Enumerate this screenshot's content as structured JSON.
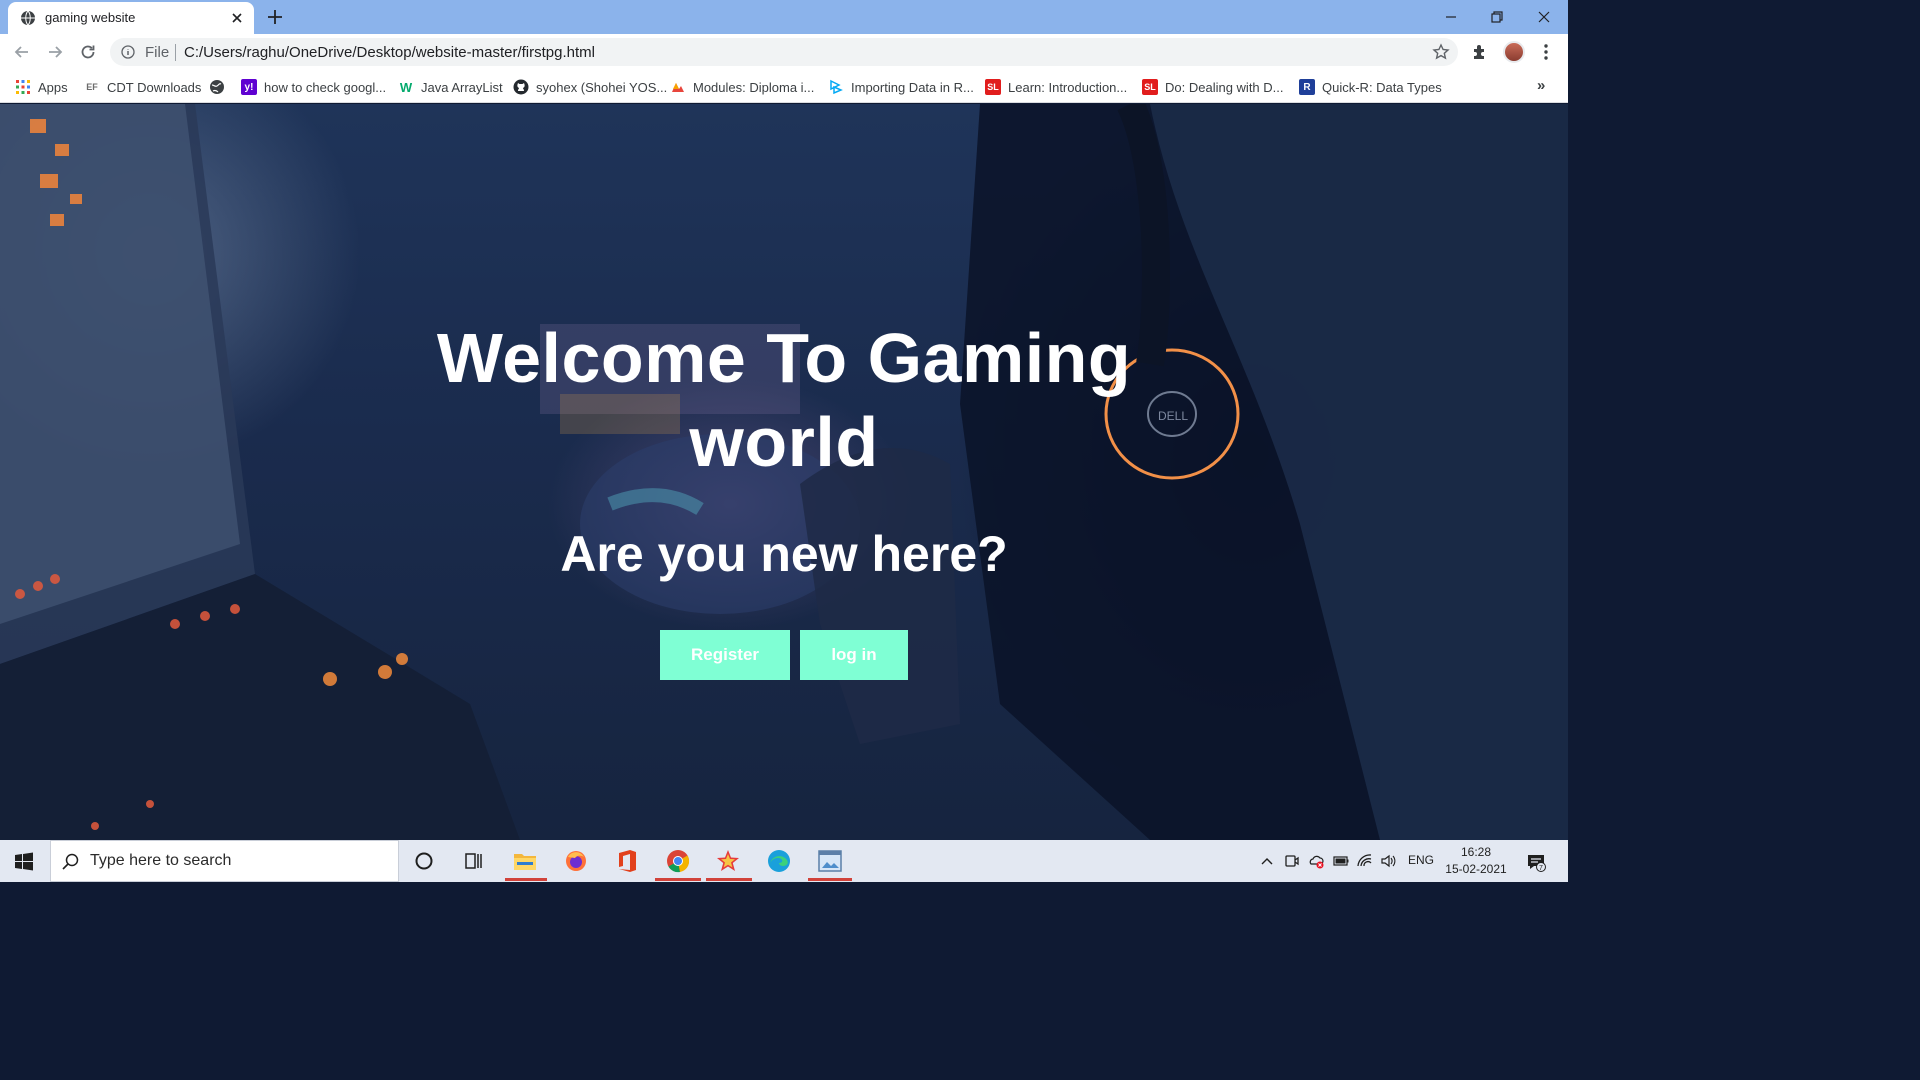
{
  "browser": {
    "tab_title": "gaming website",
    "omnibox": {
      "scheme_label": "File",
      "url": "C:/Users/raghu/OneDrive/Desktop/website-master/firstpg.html"
    }
  },
  "bookmarks": [
    {
      "label": "Apps",
      "icon": "apps-grid-icon"
    },
    {
      "label": "CDT Downloads",
      "icon": "ef-icon"
    },
    {
      "label": "",
      "icon": "globe-icon"
    },
    {
      "label": "how to check googl...",
      "icon": "yahoo-icon"
    },
    {
      "label": "Java ArrayList",
      "icon": "w3schools-icon"
    },
    {
      "label": "syohex (Shohei YOS...",
      "icon": "github-icon"
    },
    {
      "label": "Modules: Diploma i...",
      "icon": "modules-icon"
    },
    {
      "label": "Importing Data in R...",
      "icon": "datacamp-icon"
    },
    {
      "label": "Learn: Introduction...",
      "icon": "sololearn-icon"
    },
    {
      "label": "Do: Dealing with D...",
      "icon": "sololearn-icon"
    },
    {
      "label": "Quick-R: Data Types",
      "icon": "r-icon"
    }
  ],
  "page": {
    "heading_line1": "Welcome To Gaming",
    "heading_line2": "world",
    "subheading": "Are you new here?",
    "register_button": "Register",
    "login_button": "log in",
    "colors": {
      "button_bg": "#7fffd4",
      "button_text": "#ffffff",
      "heading": "#ffffff"
    }
  },
  "taskbar": {
    "search_placeholder": "Type here to search",
    "apps": [
      "cortana-icon",
      "task-view-icon",
      "file-explorer-icon",
      "firefox-icon",
      "office-icon",
      "chrome-icon",
      "star-app-icon",
      "edge-icon",
      "photos-app-icon"
    ],
    "language": "ENG",
    "time": "16:28",
    "date": "15-02-2021",
    "notification_count": "7"
  }
}
